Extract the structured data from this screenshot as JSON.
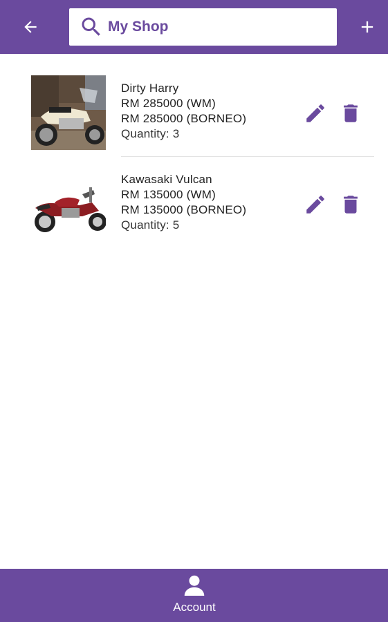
{
  "colors": {
    "primary": "#6a4a9e",
    "icon": "#6a4a9e",
    "background": "#ffffff"
  },
  "header": {
    "back_icon": "arrow-left-icon",
    "search_icon": "search-icon",
    "search_value": "My Shop",
    "add_icon": "plus-icon"
  },
  "items": [
    {
      "name": "Dirty Harry",
      "price_wm": "RM 285000 (WM)",
      "price_borneo": "RM 285000 (BORNEO)",
      "quantity": "Quantity: 3",
      "thumbnail": "cream-motorcycle-photo",
      "edit_icon": "pencil-icon",
      "delete_icon": "trash-icon"
    },
    {
      "name": "Kawasaki Vulcan",
      "price_wm": "RM 135000 (WM)",
      "price_borneo": "RM 135000 (BORNEO)",
      "quantity": "Quantity: 5",
      "thumbnail": "red-motorcycle-photo",
      "edit_icon": "pencil-icon",
      "delete_icon": "trash-icon"
    }
  ],
  "bottom_nav": {
    "icon": "person-icon",
    "label": "Account"
  }
}
